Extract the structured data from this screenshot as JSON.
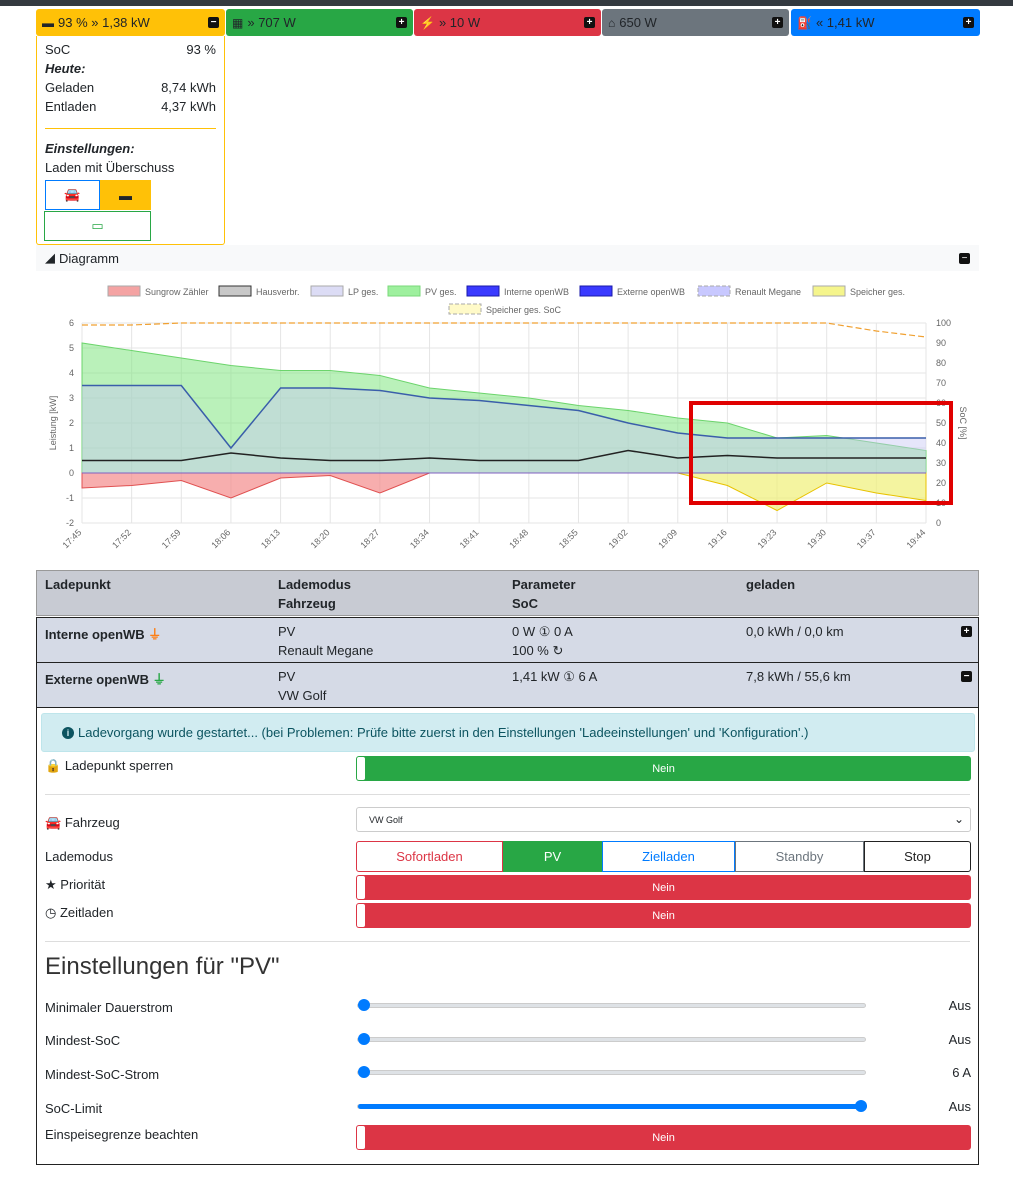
{
  "tiles": {
    "battery": {
      "soc": "93 %",
      "power": "1,38 kW",
      "color": "#ffc107"
    },
    "pv": {
      "power": "707 W",
      "color": "#28a745"
    },
    "grid": {
      "power": "10 W",
      "color": "#dc3545"
    },
    "house": {
      "power": "650 W",
      "color": "#6c757d"
    },
    "chargepoints": {
      "power": "1,41 kW",
      "color": "#007bff"
    }
  },
  "battery_panel": {
    "soc_label": "SoC",
    "soc_value": "93 %",
    "today_label": "Heute:",
    "charged_label": "Geladen",
    "charged_value": "8,74 kWh",
    "discharged_label": "Entladen",
    "discharged_value": "4,37 kWh",
    "settings_label": "Einstellungen:",
    "mode_text": "Laden mit Überschuss"
  },
  "diagram": {
    "title": "Diagramm",
    "legend": [
      "Sungrow Zähler",
      "Hausverbr.",
      "LP ges.",
      "PV ges.",
      "Interne openWB",
      "Externe openWB",
      "Renault Megane",
      "Speicher ges.",
      "Speicher ges. SoC"
    ],
    "legend_colors": [
      "#f4a3a3",
      "#c8c8c8",
      "#dcdcf5",
      "#9ef09e",
      "#3a3aff",
      "#3a3aff",
      "#c8c8ff",
      "#f5f58c",
      "#fffac8"
    ],
    "left_ylabel": "Leistung [kW]",
    "right_ylabel": "SoC [%]",
    "left_ticks": [
      "6",
      "5",
      "4",
      "3",
      "2",
      "1",
      "0",
      "-1",
      "-2"
    ],
    "right_ticks": [
      "100",
      "90",
      "80",
      "70",
      "60",
      "50",
      "40",
      "30",
      "20",
      "10",
      "0"
    ],
    "x_ticks": [
      "17:45",
      "17:52",
      "17:59",
      "18:06",
      "18:13",
      "18:20",
      "18:27",
      "18:34",
      "18:41",
      "18:48",
      "18:55",
      "19:02",
      "19:09",
      "19:16",
      "19:23",
      "19:30",
      "19:37",
      "19:44"
    ]
  },
  "chart_data": {
    "type": "area",
    "x": [
      "17:45",
      "17:52",
      "17:59",
      "18:06",
      "18:13",
      "18:20",
      "18:27",
      "18:34",
      "18:41",
      "18:48",
      "18:55",
      "19:02",
      "19:09",
      "19:16",
      "19:23",
      "19:30",
      "19:37",
      "19:44"
    ],
    "ylim": [
      -2,
      6
    ],
    "y2lim": [
      0,
      100
    ],
    "series": [
      {
        "name": "PV ges.",
        "values": [
          5.2,
          4.9,
          4.6,
          4.3,
          4.1,
          4.1,
          3.9,
          3.4,
          3.2,
          3.0,
          2.7,
          2.5,
          2.2,
          2.0,
          1.4,
          1.5,
          1.2,
          0.9
        ]
      },
      {
        "name": "Interne openWB",
        "values": [
          0,
          0,
          0,
          0,
          0,
          0,
          0,
          0,
          0,
          0,
          0,
          0,
          0,
          0,
          0,
          0,
          0,
          0
        ]
      },
      {
        "name": "Externe openWB",
        "values": [
          3.5,
          3.5,
          3.5,
          1.0,
          3.4,
          3.4,
          3.3,
          3.0,
          2.9,
          2.7,
          2.5,
          2.0,
          1.6,
          1.4,
          1.4,
          1.4,
          1.4,
          1.4
        ]
      },
      {
        "name": "Hausverbr.",
        "values": [
          0.5,
          0.5,
          0.5,
          0.8,
          0.6,
          0.5,
          0.5,
          0.6,
          0.5,
          0.5,
          0.5,
          0.9,
          0.6,
          0.7,
          0.6,
          0.6,
          0.6,
          0.6
        ]
      },
      {
        "name": "Speicher ges.",
        "values": [
          0,
          0,
          0,
          0,
          0,
          0,
          0,
          0,
          0,
          0,
          0,
          0,
          0,
          -0.5,
          -1.5,
          -0.4,
          -0.8,
          -1.1
        ]
      },
      {
        "name": "Sungrow Zähler",
        "values": [
          -0.6,
          -0.5,
          -0.3,
          -1.0,
          -0.2,
          -0.1,
          -0.8,
          0,
          0,
          0,
          0,
          0,
          0,
          0,
          0,
          0,
          0,
          0
        ]
      },
      {
        "name": "Speicher ges. SoC",
        "values": [
          99,
          99,
          100,
          100,
          100,
          100,
          100,
          100,
          100,
          100,
          100,
          100,
          100,
          100,
          100,
          100,
          96,
          93
        ]
      }
    ]
  },
  "lp_table": {
    "headers": {
      "c1": "Ladepunkt",
      "c2a": "Lademodus",
      "c2b": "Fahrzeug",
      "c3a": "Parameter",
      "c3b": "SoC",
      "c4": "geladen"
    },
    "rows": [
      {
        "name": "Interne openWB",
        "mode": "PV",
        "vehicle": "Renault Megane",
        "param": "0 W ① 0 A",
        "soc": "100 %",
        "charged": "0,0 kWh / 0,0 km"
      },
      {
        "name": "Externe openWB",
        "mode": "PV",
        "vehicle": "VW Golf",
        "param": "1,41 kW ① 6 A",
        "soc": "",
        "charged": "7,8 kWh / 55,6 km"
      }
    ]
  },
  "details": {
    "alert": "Ladevorgang wurde gestartet... (bei Problemen: Prüfe bitte zuerst in den Einstellungen 'Ladeeinstellungen' und 'Konfiguration'.)",
    "lock_label": "Ladepunkt sperren",
    "lock_value": "Nein",
    "vehicle_label": "Fahrzeug",
    "vehicle_value": "VW Golf",
    "mode_label": "Lademodus",
    "modes": [
      "Sofortladen",
      "PV",
      "Zielladen",
      "Standby",
      "Stop"
    ],
    "priority_label": "Priorität",
    "priority_value": "Nein",
    "timed_label": "Zeitladen",
    "timed_value": "Nein",
    "pv_heading": "Einstellungen für \"PV\"",
    "sliders": [
      {
        "label": "Minimaler Dauerstrom",
        "value": "Aus",
        "fraction": 0
      },
      {
        "label": "Mindest-SoC",
        "value": "Aus",
        "fraction": 0
      },
      {
        "label": "Mindest-SoC-Strom",
        "value": "6 A",
        "fraction": 0
      },
      {
        "label": "SoC-Limit",
        "value": "Aus",
        "fraction": 1
      }
    ],
    "feedin_label": "Einspeisegrenze beachten",
    "feedin_value": "Nein"
  }
}
